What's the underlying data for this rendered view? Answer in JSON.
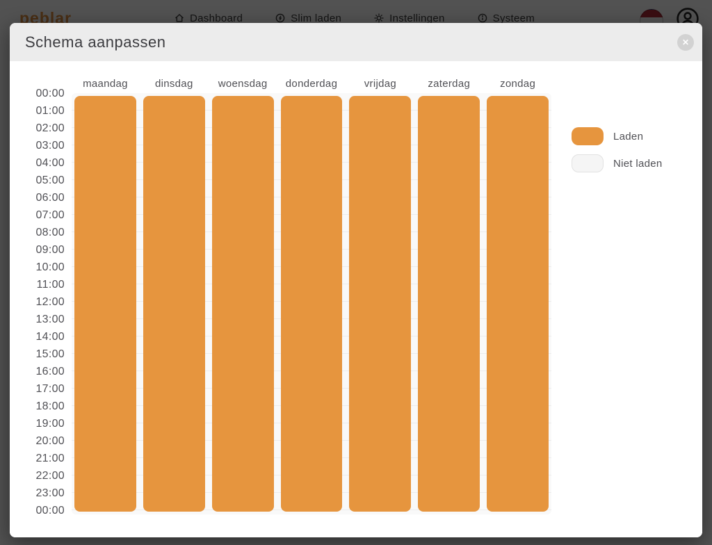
{
  "nav": {
    "logo": "peblar",
    "items": [
      {
        "label": "Dashboard",
        "icon": "home-icon"
      },
      {
        "label": "Slim laden",
        "icon": "ev-charging-icon"
      },
      {
        "label": "Instellingen",
        "icon": "gear-icon"
      },
      {
        "label": "Systeem",
        "icon": "info-icon"
      }
    ]
  },
  "modal": {
    "title": "Schema aanpassen",
    "close_icon": "✕"
  },
  "schedule": {
    "days": [
      "maandag",
      "dinsdag",
      "woensdag",
      "donderdag",
      "vrijdag",
      "zaterdag",
      "zondag"
    ],
    "hours": [
      "00:00",
      "01:00",
      "02:00",
      "03:00",
      "04:00",
      "05:00",
      "06:00",
      "07:00",
      "08:00",
      "09:00",
      "10:00",
      "11:00",
      "12:00",
      "13:00",
      "14:00",
      "15:00",
      "16:00",
      "17:00",
      "18:00",
      "19:00",
      "20:00",
      "21:00",
      "22:00",
      "23:00",
      "00:00"
    ],
    "day_schedule": [
      {
        "day": "maandag",
        "state": "laden",
        "from": "00:00",
        "to": "00:00"
      },
      {
        "day": "dinsdag",
        "state": "laden",
        "from": "00:00",
        "to": "00:00"
      },
      {
        "day": "woensdag",
        "state": "laden",
        "from": "00:00",
        "to": "00:00"
      },
      {
        "day": "donderdag",
        "state": "laden",
        "from": "00:00",
        "to": "00:00"
      },
      {
        "day": "vrijdag",
        "state": "laden",
        "from": "00:00",
        "to": "00:00"
      },
      {
        "day": "zaterdag",
        "state": "laden",
        "from": "00:00",
        "to": "00:00"
      },
      {
        "day": "zondag",
        "state": "laden",
        "from": "00:00",
        "to": "00:00"
      }
    ]
  },
  "legend": [
    {
      "label": "Laden",
      "state": "laden",
      "color": "#E6953E"
    },
    {
      "label": "Niet laden",
      "state": "niet-laden",
      "color": "#F5F5F5"
    }
  ],
  "colors": {
    "accent_orange": "#E6953E",
    "modal_header": "#ECECEC",
    "grid_background": "#F9F9F9",
    "grid_line": "#ECECEC",
    "flag_red": "#AE1C28",
    "flag_blue": "#21468B"
  }
}
